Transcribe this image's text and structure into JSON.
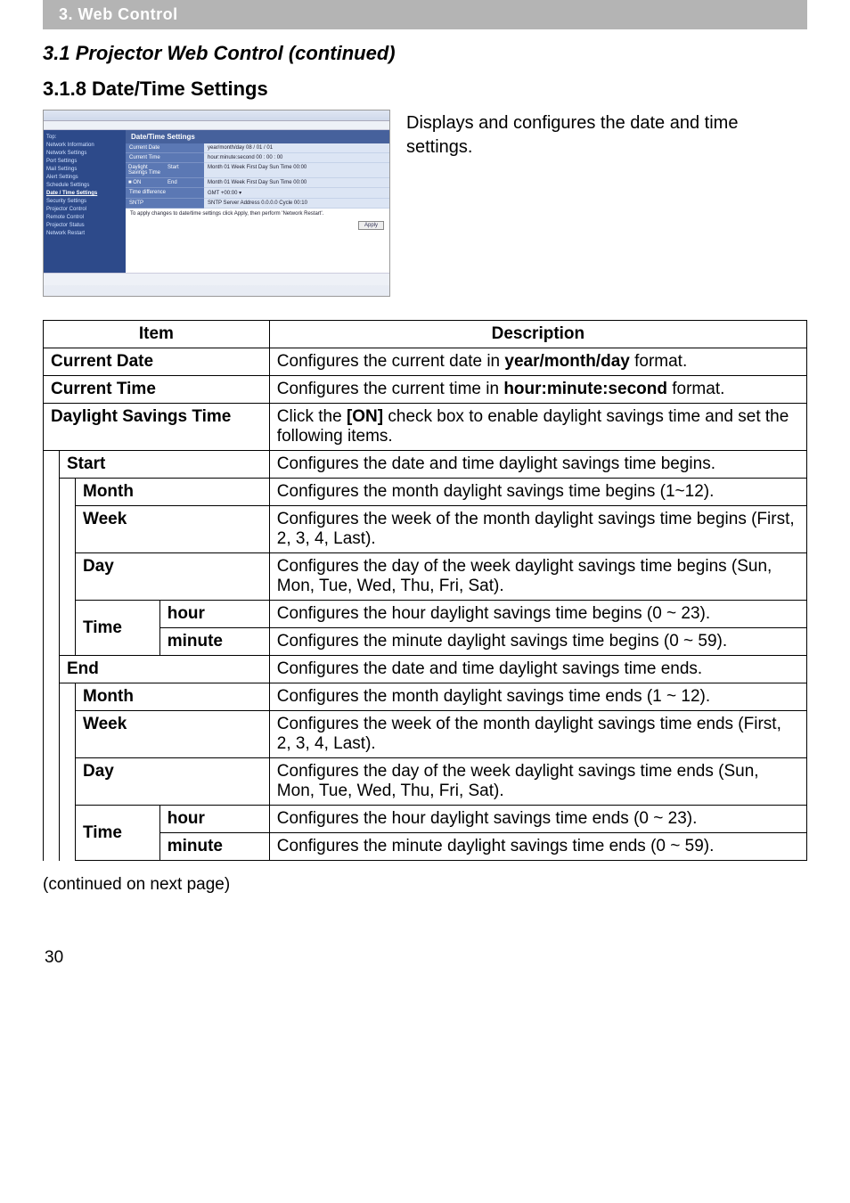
{
  "chapter": "3. Web Control",
  "section_title": "3.1 Projector Web Control (continued)",
  "subsection_title": "3.1.8 Date/Time Settings",
  "intro_text": "Displays and configures the date and time settings.",
  "thumb": {
    "header": "Date/Time Settings",
    "sidebar": [
      "Top:",
      "Network Information",
      "Network Settings",
      "Port Settings",
      "Mail Settings",
      "Alert Settings",
      "Schedule Settings",
      "Date / Time Settings",
      "Security Settings",
      "Projector Control",
      "Remote Control",
      "Projector Status",
      "Network Restart"
    ],
    "labels": {
      "current_date": "Current Date",
      "current_time": "Current Time",
      "dst": "Daylight Savings Time",
      "start": "Start",
      "end": "End",
      "time_diff": "Time difference",
      "sntp": "SNTP",
      "note": "To apply changes to date/time settings click Apply, then perform 'Network Restart'.",
      "apply": "Apply"
    }
  },
  "table": {
    "head_item": "Item",
    "head_desc": "Description",
    "rows": {
      "current_date": {
        "item": "Current Date",
        "desc_pre": "Configures the current date in ",
        "desc_b": "year/month/day",
        "desc_post": " format."
      },
      "current_time": {
        "item": "Current Time",
        "desc_pre": "Configures the current time in ",
        "desc_b": "hour:minute:second",
        "desc_post": " format."
      },
      "dst": {
        "item": "Daylight Savings Time",
        "desc_pre": "Click the ",
        "desc_b": "[ON]",
        "desc_post": " check box to enable daylight savings time and set the following items."
      },
      "start": {
        "item": "Start",
        "desc": "Configures the date and time daylight savings time begins."
      },
      "start_month": {
        "item": "Month",
        "desc": "Configures the month daylight savings time begins (1~12)."
      },
      "start_week": {
        "item": "Week",
        "desc": "Configures the week of the month daylight savings time begins (First, 2, 3, 4, Last)."
      },
      "start_day": {
        "item": "Day",
        "desc": "Configures the day of the week daylight savings time begins (Sun, Mon, Tue, Wed, Thu, Fri, Sat)."
      },
      "start_time": {
        "item": "Time"
      },
      "start_hour": {
        "item": "hour",
        "desc": "Configures the hour daylight savings time begins (0 ~ 23)."
      },
      "start_minute": {
        "item": "minute",
        "desc": "Configures the minute daylight savings time begins (0 ~ 59)."
      },
      "end": {
        "item": "End",
        "desc": "Configures the date and time daylight savings time ends."
      },
      "end_month": {
        "item": "Month",
        "desc": "Configures the month daylight savings time ends (1 ~ 12)."
      },
      "end_week": {
        "item": "Week",
        "desc": "Configures the week of the month daylight savings time ends (First, 2, 3, 4, Last)."
      },
      "end_day": {
        "item": "Day",
        "desc": "Configures the day of the week daylight savings time ends (Sun, Mon, Tue, Wed, Thu, Fri, Sat)."
      },
      "end_time": {
        "item": "Time"
      },
      "end_hour": {
        "item": "hour",
        "desc": "Configures the hour daylight savings time ends (0 ~ 23)."
      },
      "end_minute": {
        "item": "minute",
        "desc": "Configures the minute daylight savings time ends (0 ~ 59)."
      }
    }
  },
  "continued": "(continued on next page)",
  "page_number": "30"
}
